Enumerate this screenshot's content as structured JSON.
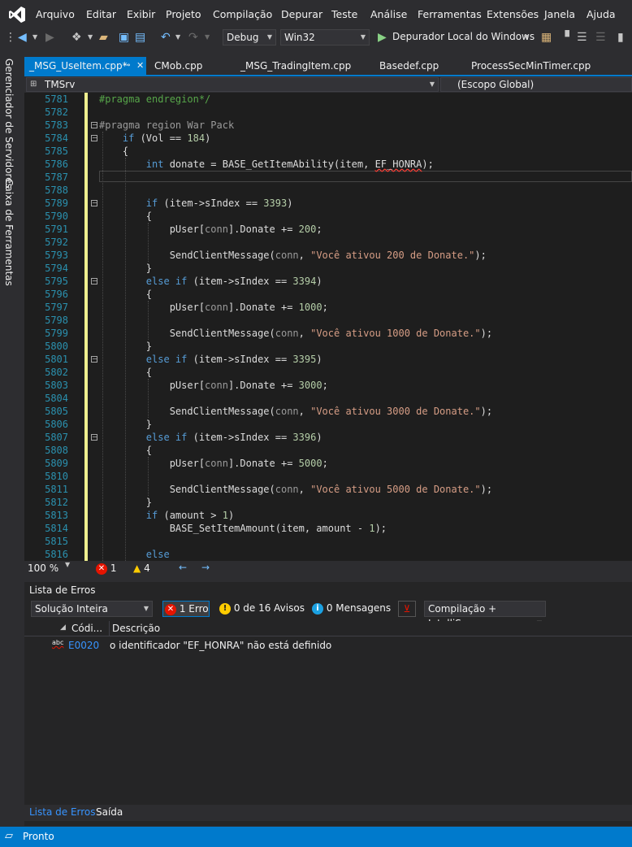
{
  "menubar": {
    "items": [
      "Arquivo",
      "Editar",
      "Exibir",
      "Projeto",
      "Compilação",
      "Depurar",
      "Teste",
      "Análise",
      "Ferramentas",
      "Extensões",
      "Janela",
      "Ajuda"
    ]
  },
  "toolbar": {
    "config": "Debug",
    "platform": "Win32",
    "debugger": "Depurador Local do Windows"
  },
  "siderail": {
    "tab1": "Gerenciador de Servidores",
    "tab2": "Caixa de Ferramentas"
  },
  "tabs": [
    {
      "label": "_MSG_UseItem.cpp*",
      "active": true
    },
    {
      "label": "CMob.cpp",
      "active": false
    },
    {
      "label": "_MSG_TradingItem.cpp",
      "active": false
    },
    {
      "label": "Basedef.cpp",
      "active": false
    },
    {
      "label": "ProcessSecMinTimer.cpp",
      "active": false
    }
  ],
  "navbar": {
    "project": "TMSrv",
    "scope": "(Escopo Global)"
  },
  "editor": {
    "line_numbers": [
      "5781",
      "5782",
      "5783",
      "5784",
      "5785",
      "5786",
      "5787",
      "5788",
      "5789",
      "5790",
      "5791",
      "5792",
      "5793",
      "5794",
      "5795",
      "5796",
      "5797",
      "5798",
      "5799",
      "5800",
      "5801",
      "5802",
      "5803",
      "5804",
      "5805",
      "5806",
      "5807",
      "5808",
      "5809",
      "5810",
      "5811",
      "5812",
      "5813",
      "5814",
      "5815",
      "5816"
    ],
    "zoom": "100 %",
    "errors": "1",
    "warnings": "4"
  },
  "errorlist": {
    "title": "Lista de Erros",
    "scope": "Solução Inteira",
    "errors_btn": "1 Erro",
    "warnings_btn": "0 de 16 Avisos",
    "messages_btn": "0 Mensagens",
    "build_filter": "Compilação + IntelliSens",
    "col_code": "Códi...",
    "col_desc": "Descrição",
    "rows": [
      {
        "code": "E0020",
        "description": "o identificador \"EF_HONRA\" não está definido"
      }
    ]
  },
  "bottomtabs": [
    "Lista de Erros",
    "Saída"
  ],
  "status": {
    "text": "Pronto"
  },
  "colors": {
    "accent": "#007acc",
    "background": "#2d2d30",
    "editor": "#1e1e1e",
    "keyword": "#569cd6",
    "string": "#d69d85",
    "number": "#b5cea8",
    "comment": "#57a64a",
    "line_number": "#2b91af",
    "error": "#e51400"
  }
}
